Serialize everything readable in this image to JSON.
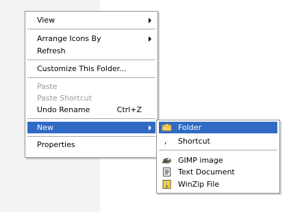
{
  "context_menu": {
    "items": [
      {
        "label": "View"
      },
      {
        "label": "Arrange Icons By"
      },
      {
        "label": "Refresh"
      },
      {
        "label": "Customize This Folder..."
      },
      {
        "label": "Paste"
      },
      {
        "label": "Paste Shortcut"
      },
      {
        "label": "Undo Rename",
        "shortcut": "Ctrl+Z"
      },
      {
        "label": "New"
      },
      {
        "label": "Properties"
      }
    ]
  },
  "new_submenu": {
    "items": [
      {
        "label": "Folder",
        "icon": "folder-icon"
      },
      {
        "label": "Shortcut",
        "icon": "shortcut-icon"
      },
      {
        "label": "GIMP image",
        "icon": "gimp-image-icon"
      },
      {
        "label": "Text Document",
        "icon": "text-document-icon"
      },
      {
        "label": "WinZip File",
        "icon": "winzip-icon"
      }
    ]
  },
  "colors": {
    "highlight": "#316ac5",
    "disabled_text": "#9a9a9a",
    "menu_border": "#8d8d8d"
  }
}
